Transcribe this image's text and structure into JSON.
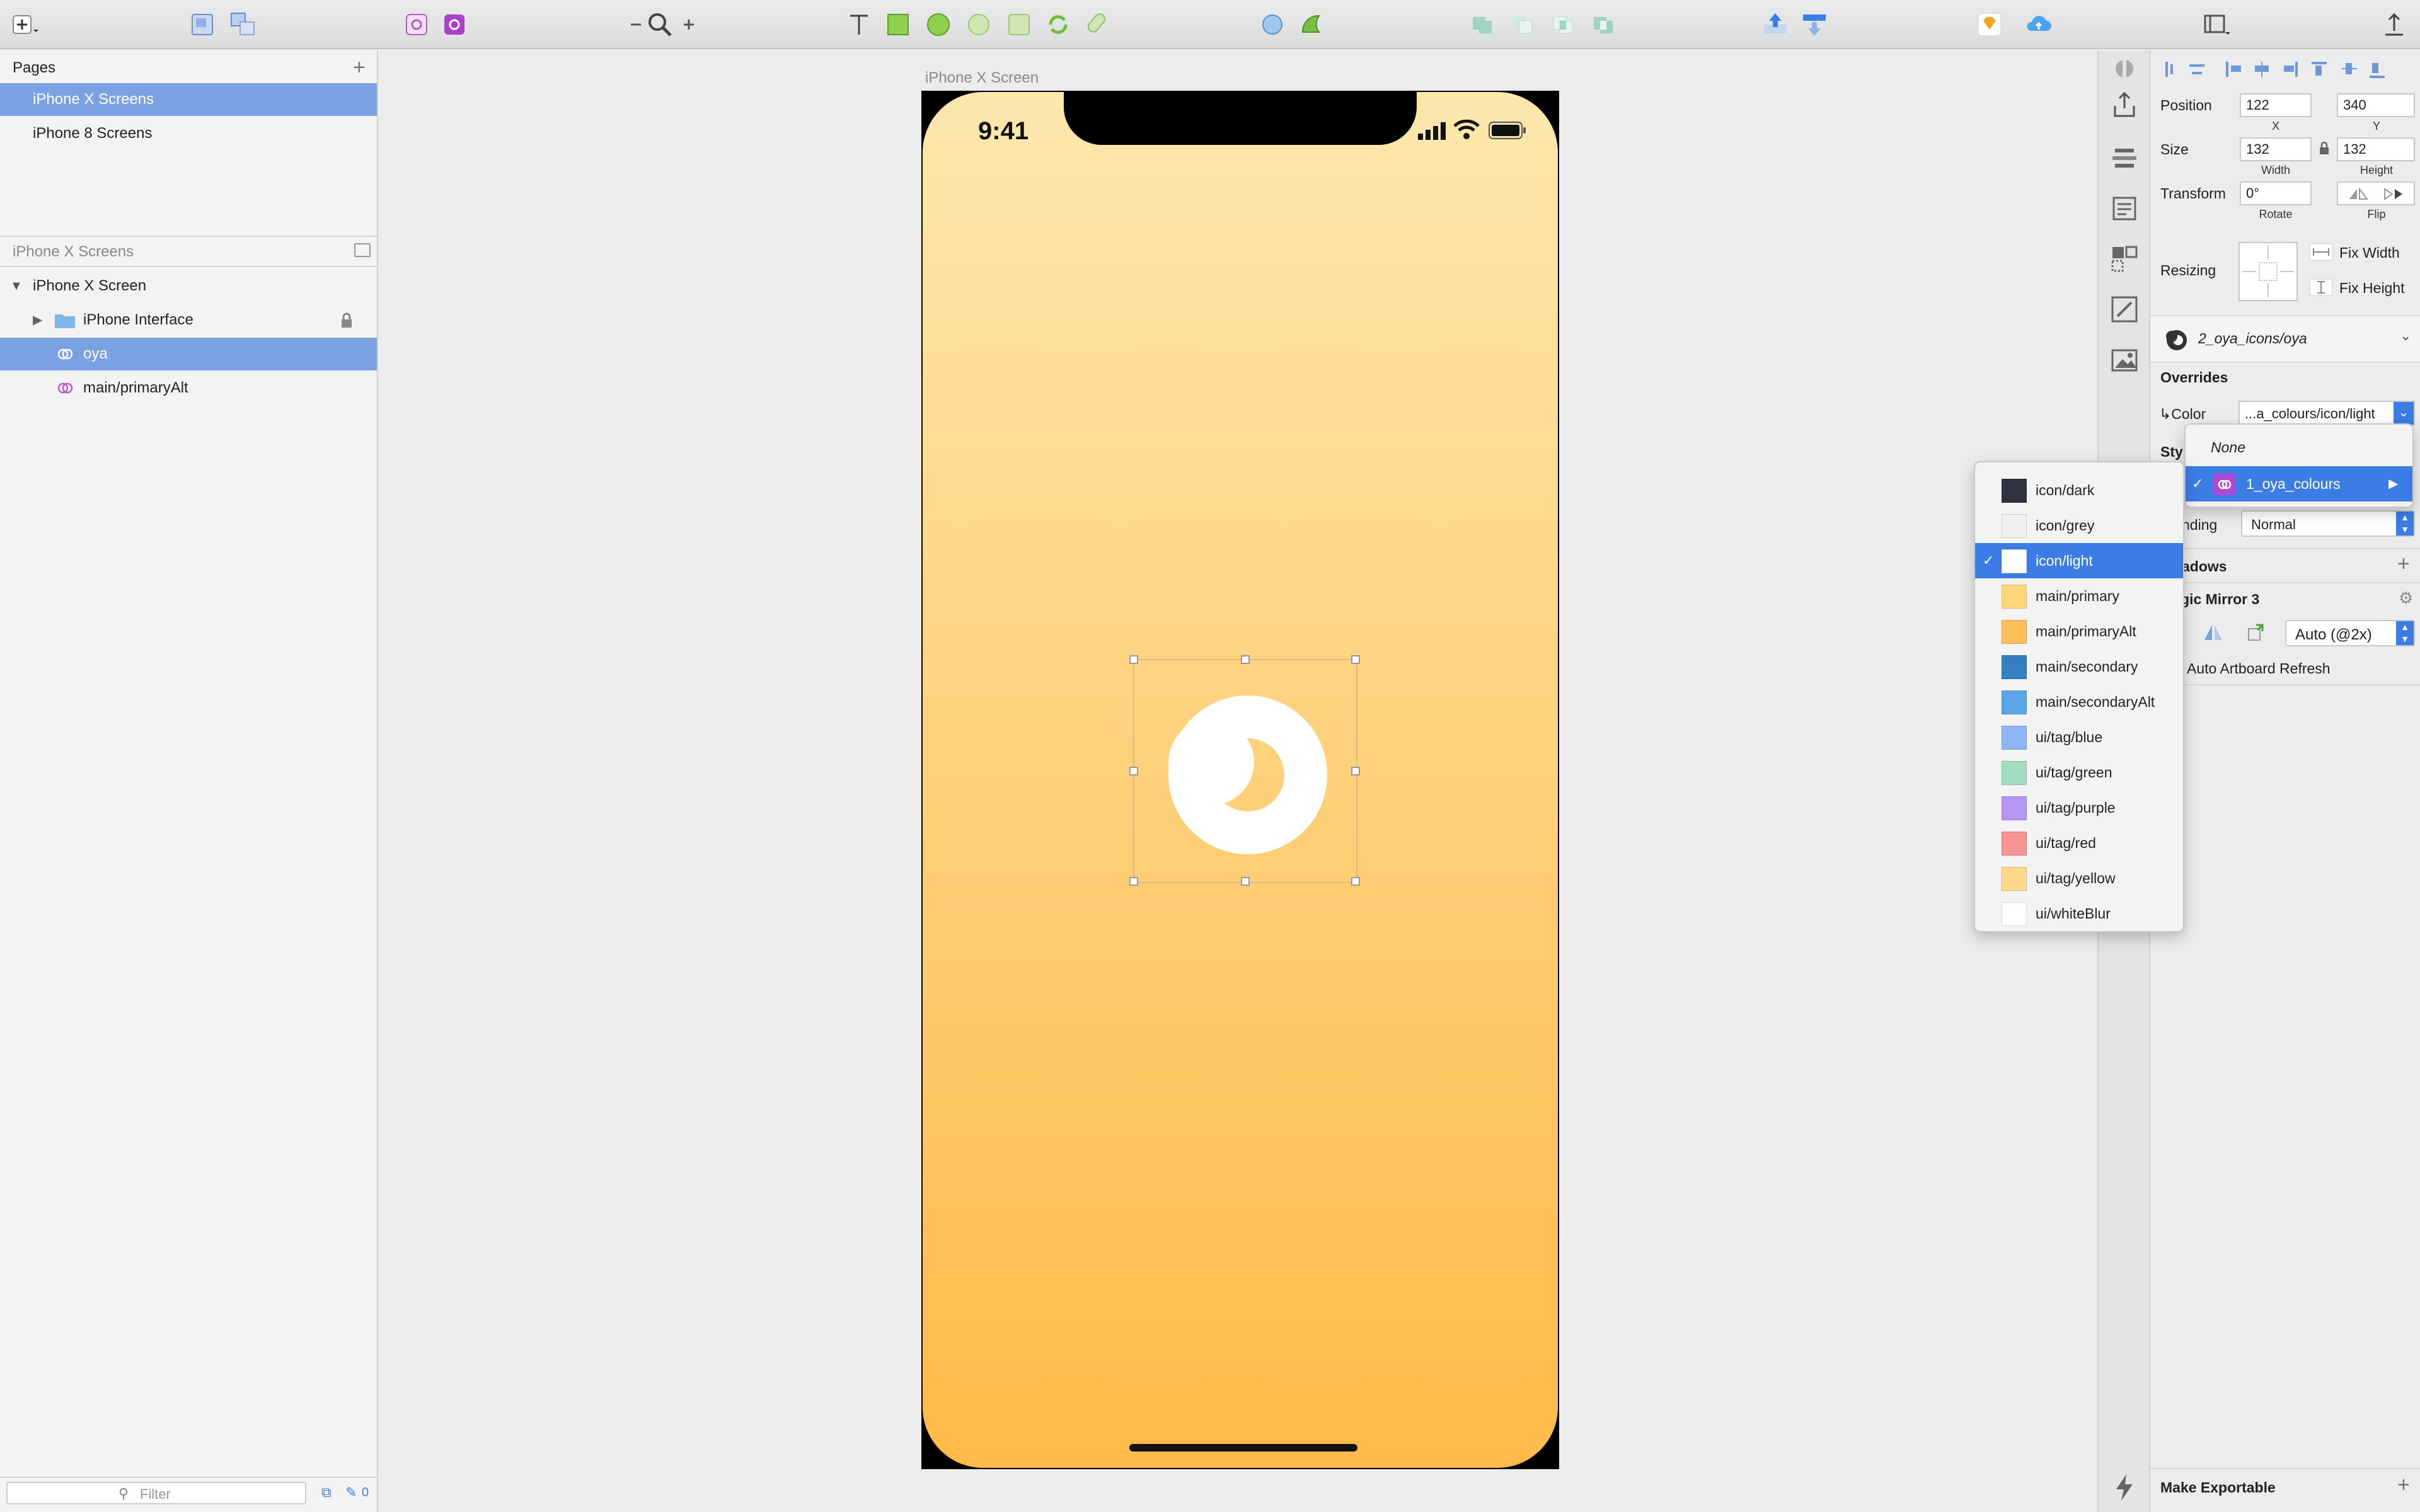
{
  "toolbar": {
    "icons": [
      "insert-icon",
      "group-icon",
      "ungroup-icon",
      "create-symbol-icon",
      "symbols-icon",
      "zoom-out-icon",
      "zoom-icon",
      "zoom-in-icon",
      "text-icon",
      "rectangle-icon",
      "oval-icon",
      "rounded-icon",
      "shape-icon",
      "rotate-icon",
      "flatten-icon",
      "mask-icon",
      "scale-icon",
      "union-icon",
      "subtract-icon",
      "intersect-icon",
      "difference-icon",
      "forward-icon",
      "backward-icon",
      "sketch-cloud-icon",
      "cloud-icon",
      "view-icon",
      "export-icon"
    ]
  },
  "pages": {
    "header": "Pages",
    "items": [
      "iPhone X Screens",
      "iPhone 8 Screens"
    ],
    "selected_index": 0
  },
  "layers": {
    "header": "iPhone X Screens",
    "artboard": "iPhone X Screen",
    "items": [
      {
        "name": "iPhone Interface",
        "kind": "group",
        "locked": true
      },
      {
        "name": "oya",
        "kind": "symbol",
        "selected": true
      },
      {
        "name": "main/primaryAlt",
        "kind": "symbol"
      }
    ],
    "filter_placeholder": "Filter",
    "edited_count": "0"
  },
  "canvas": {
    "artboard_title": "iPhone X Screen",
    "status_time": "9:41",
    "gradient_top": "#fde7ad",
    "gradient_bottom": "#ffba48"
  },
  "inspector": {
    "position_label": "Position",
    "x": "122",
    "y": "340",
    "x_label": "X",
    "y_label": "Y",
    "size_label": "Size",
    "width": "132",
    "height": "132",
    "width_label": "Width",
    "height_label": "Height",
    "transform_label": "Transform",
    "rotate": "0°",
    "rotate_label": "Rotate",
    "flip_label": "Flip",
    "resizing_label": "Resizing",
    "fix_width": "Fix Width",
    "fix_height": "Fix Height",
    "symbol_name": "2_oya_icons/oya",
    "overrides_label": "Overrides",
    "color_label": "↳Color",
    "color_value": "...a_colours/icon/light",
    "style_label_partial": "Sty",
    "blending_label_partial": "nding",
    "blending_value": "Normal",
    "shadows_partial": "adows",
    "magic_mirror_partial": "gic Mirror 3",
    "auto_scale": "Auto (@2x)",
    "auto_refresh": "Auto Artboard Refresh",
    "make_exportable": "Make Exportable"
  },
  "library_menu": {
    "none": "None",
    "library": "1_oya_colours"
  },
  "color_menu": {
    "items": [
      {
        "name": "icon/dark",
        "color": "#2f3341",
        "selected": false
      },
      {
        "name": "icon/grey",
        "color": "#efefef",
        "selected": false
      },
      {
        "name": "icon/light",
        "color": "#ffffff",
        "selected": true
      },
      {
        "name": "main/primary",
        "color": "#ffd67a",
        "selected": false
      },
      {
        "name": "main/primaryAlt",
        "color": "#ffc05a",
        "selected": false
      },
      {
        "name": "main/secondary",
        "color": "#3480c2",
        "selected": false
      },
      {
        "name": "main/secondaryAlt",
        "color": "#5aa6e6",
        "selected": false
      },
      {
        "name": "ui/tag/blue",
        "color": "#8eb6f5",
        "selected": false
      },
      {
        "name": "ui/tag/green",
        "color": "#a3ddc0",
        "selected": false
      },
      {
        "name": "ui/tag/purple",
        "color": "#b596f3",
        "selected": false
      },
      {
        "name": "ui/tag/red",
        "color": "#f69393",
        "selected": false
      },
      {
        "name": "ui/tag/yellow",
        "color": "#ffd98a",
        "selected": false
      },
      {
        "name": "ui/whiteBlur",
        "color": "#ffffff",
        "selected": false
      }
    ]
  }
}
